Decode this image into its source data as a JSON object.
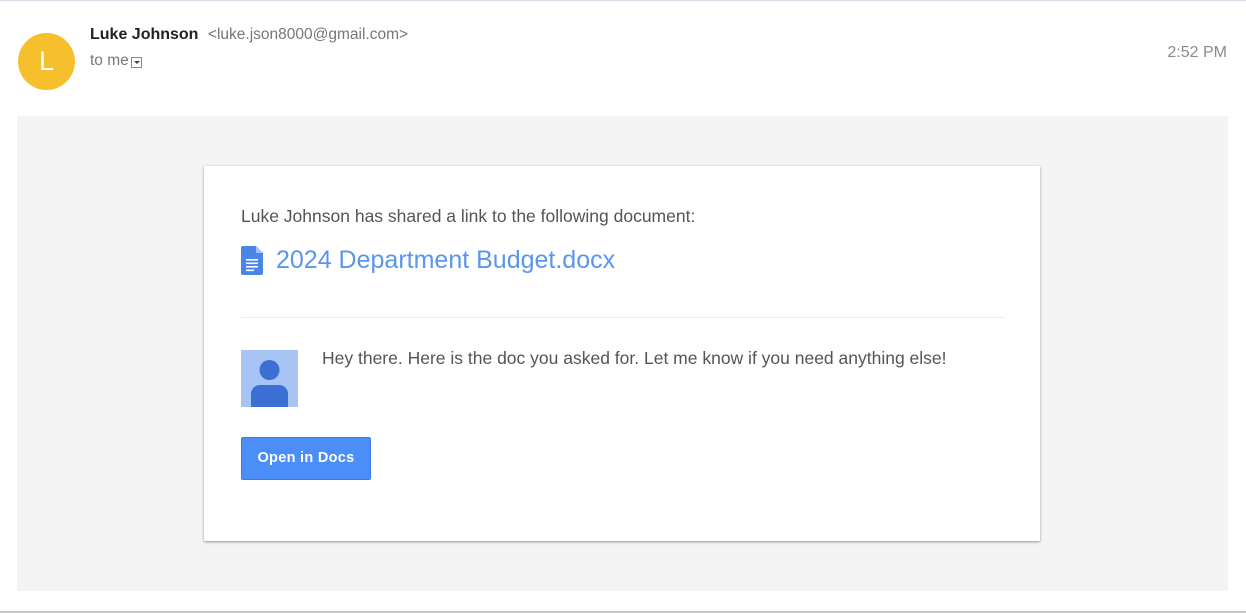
{
  "header": {
    "avatar_letter": "L",
    "sender_name": "Luke Johnson",
    "sender_email": "<luke.json8000@gmail.com>",
    "recipient_label": "to me",
    "timestamp": "2:52 PM"
  },
  "share_card": {
    "intro_text": "Luke Johnson has shared a link to the following document:",
    "document_title": "2024 Department Budget.docx",
    "document_icon": "google-docs-icon",
    "message": "Hey there. Here is the doc you asked for. Let me know if you need anything else!",
    "sender_picture_icon": "default-profile-icon",
    "open_button_label": "Open in Docs"
  },
  "colors": {
    "avatar_bg": "#f6c02c",
    "link_color": "#5a96ee",
    "button_bg": "#4c8ef7",
    "body_bg": "#f4f4f4"
  }
}
